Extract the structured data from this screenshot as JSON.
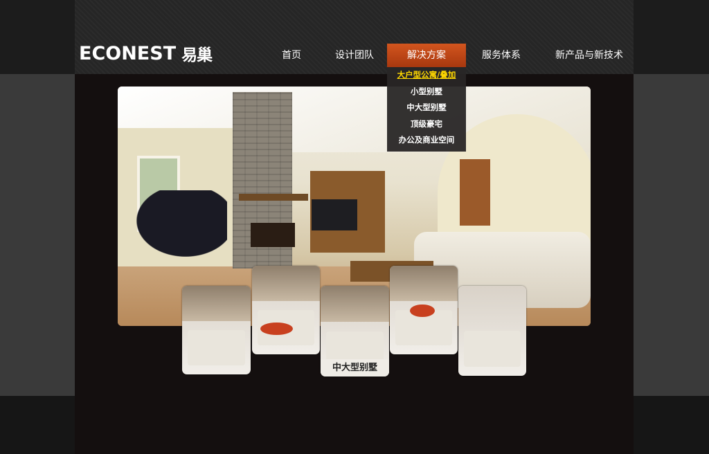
{
  "brand": {
    "logo_text": "ECONEST",
    "logo_cn": "易巢"
  },
  "nav": {
    "items": [
      {
        "label": "首页"
      },
      {
        "label": "设计团队"
      },
      {
        "label": "解决方案"
      },
      {
        "label": "服务体系"
      },
      {
        "label": "新产品与新技术"
      }
    ],
    "active_index": 2
  },
  "dropdown": {
    "items": [
      {
        "label": "大户型公寓/叠加"
      },
      {
        "label": "小型别墅"
      },
      {
        "label": "中大型别墅"
      },
      {
        "label": "顶级豪宅"
      },
      {
        "label": "办公及商业空间"
      }
    ],
    "hover_index": 0
  },
  "gallery": {
    "thumbnails": [
      {
        "icon": "interior-thumbnail-icon"
      },
      {
        "icon": "interior-thumbnail-icon"
      },
      {
        "icon": "interior-thumbnail-icon",
        "label": "中大型别墅"
      },
      {
        "icon": "interior-thumbnail-icon"
      },
      {
        "icon": "interior-thumbnail-icon"
      }
    ],
    "active_index": 2
  },
  "colors": {
    "accent": "#c24a19",
    "dropdown_highlight": "#ffd800",
    "header_bg": "#262626"
  }
}
